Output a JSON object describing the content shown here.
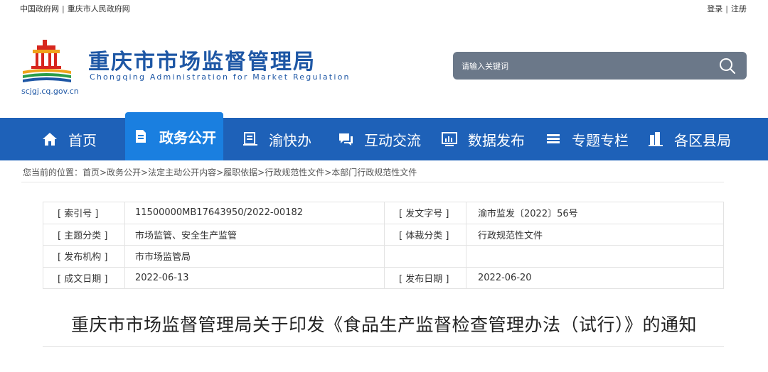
{
  "topbar": {
    "link_gov": "中国政府网",
    "link_cq": "重庆市人民政府网",
    "login": "登录",
    "register": "注册",
    "sep": "|"
  },
  "header": {
    "title": "重庆市市场监督管理局",
    "subtitle": "Chongqing  Administration for Market Regulation",
    "domain": "scjgj.cq.gov.cn"
  },
  "search": {
    "placeholder": "请输入关键词"
  },
  "nav": {
    "items": [
      {
        "label": "首页",
        "icon": "home-icon"
      },
      {
        "label": "政务公开",
        "icon": "document-icon",
        "active": true
      },
      {
        "label": "渝快办",
        "icon": "service-icon"
      },
      {
        "label": "互动交流",
        "icon": "chat-icon"
      },
      {
        "label": "数据发布",
        "icon": "chart-icon"
      },
      {
        "label": "专题专栏",
        "icon": "list-icon"
      },
      {
        "label": "各区县局",
        "icon": "building-icon"
      }
    ]
  },
  "breadcrumb": "您当前的位置：首页>政务公开>法定主动公开内容>履职依据>行政规范性文件>本部门行政规范性文件",
  "meta": {
    "rows": [
      {
        "k1": "[ 索引号 ]",
        "v1": "11500000MB17643950/2022-00182",
        "k2": "[ 发文字号 ]",
        "v2": "渝市监发〔2022〕56号"
      },
      {
        "k1": "[ 主题分类 ]",
        "v1": "市场监管、安全生产监管",
        "k2": "[ 体裁分类 ]",
        "v2": "行政规范性文件"
      },
      {
        "k1": "[ 发布机构 ]",
        "v1": "市市场监管局",
        "k2": "",
        "v2": ""
      },
      {
        "k1": "[ 成文日期 ]",
        "v1": "2022-06-13",
        "k2": "[ 发布日期 ]",
        "v2": "2022-06-20"
      }
    ]
  },
  "document": {
    "title": "重庆市市场监督管理局关于印发《食品生产监督检查管理办法（试行）》的通知"
  },
  "colors": {
    "brand_blue": "#1e57a5",
    "nav_bg": "#1e61b8",
    "nav_active": "#1a7fe0",
    "search_bg": "#6b7889"
  }
}
